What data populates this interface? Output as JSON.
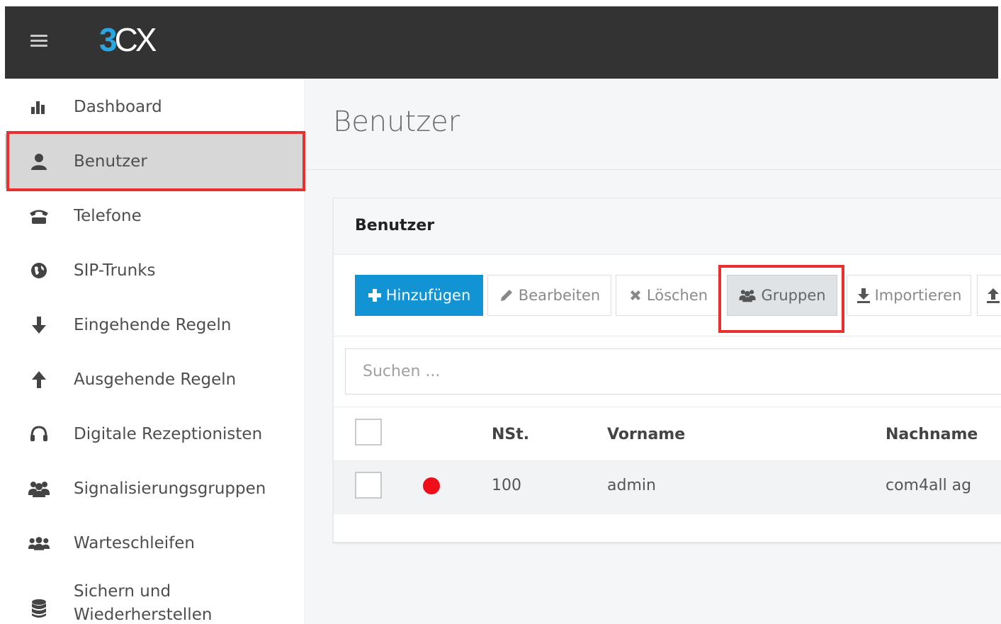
{
  "app": {
    "logo_text_3": "3",
    "logo_text_cx": "CX",
    "brand_color": "#2aa7e0"
  },
  "sidebar": {
    "items": [
      {
        "label": "Dashboard",
        "icon": "bar-chart-icon"
      },
      {
        "label": "Benutzer",
        "icon": "user-icon",
        "active": true
      },
      {
        "label": "Telefone",
        "icon": "phone-icon"
      },
      {
        "label": "SIP-Trunks",
        "icon": "globe-icon"
      },
      {
        "label": "Eingehende Regeln",
        "icon": "arrow-down-icon"
      },
      {
        "label": "Ausgehende Regeln",
        "icon": "arrow-up-icon"
      },
      {
        "label": "Digitale Rezeptionisten",
        "icon": "headset-icon"
      },
      {
        "label": "Signalisierungsgruppen",
        "icon": "users-group-icon"
      },
      {
        "label": "Warteschleifen",
        "icon": "queue-users-icon"
      },
      {
        "label": "Sichern und Wiederherstellen",
        "icon": "database-icon"
      }
    ]
  },
  "main": {
    "page_title": "Benutzer",
    "card_title": "Benutzer",
    "toolbar": {
      "add": "Hinzufügen",
      "edit": "Bearbeiten",
      "delete": "Löschen",
      "groups": "Gruppen",
      "import": "Importieren"
    },
    "search": {
      "placeholder": "Suchen ..."
    },
    "table": {
      "columns": [
        "NSt.",
        "Vorname",
        "Nachname"
      ],
      "rows": [
        {
          "ext": "100",
          "first_name": "admin",
          "last_name": "com4all ag",
          "status_color": "#ee0f1a"
        }
      ]
    }
  }
}
